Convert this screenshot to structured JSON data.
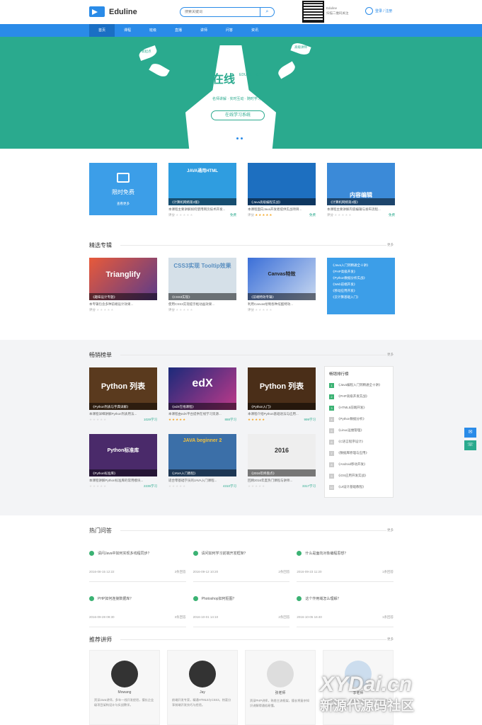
{
  "header": {
    "logo_text": "Eduline",
    "search_placeholder": "搜索关键词",
    "qr_text_1": "Eduline",
    "qr_text_2": "扫描二维码关注",
    "login_text": "登录 / 注册"
  },
  "nav": [
    "首页",
    "课程",
    "班级",
    "直播",
    "讲师",
    "问答",
    "资讯"
  ],
  "banner": {
    "title": "在线",
    "title_sub": "EDULINE 教育",
    "tagline": "名师讲解 · 实时互动 · 随时学习",
    "button": "在线学习系统",
    "leaves": [
      "新起点",
      "高级讲师",
      "新起点",
      "高级讲师"
    ]
  },
  "row1": {
    "free_title": "限时免费",
    "free_more": "查看更多",
    "cards": [
      {
        "cap": "《计算机网络第2版》",
        "big": "JAVA通用HTML",
        "desc": "本课程主要讲解如何使用网页技术开发...",
        "meta": "评分",
        "count": "免费",
        "bg": "#2f9de0"
      },
      {
        "cap": "《Java高级编程实战》",
        "big": "",
        "desc": "本课程面向Java开发者提供实战项目...",
        "meta": "评分",
        "count": "免费",
        "bg": "#1d6fc0"
      },
      {
        "cap": "《计算机网络第2版》",
        "big": "内容编辑",
        "desc": "本课程主要讲解内容编辑与发布流程...",
        "meta": "评分",
        "count": "免费",
        "bg": "#3b8ad8"
      }
    ]
  },
  "sec2": {
    "title": "精选专辑",
    "more": "更多",
    "cards": [
      {
        "cap": "《趣味设计专题》",
        "big": "Trianglify",
        "desc": "本专辑包含多种前端设计效果...",
        "meta": "评分",
        "bg": "#5b3b8a"
      },
      {
        "cap": "《CSS3实现》",
        "big": "CSS3实现 Tooltip效果",
        "desc": "使用CSS3实现提示框动画效果...",
        "meta": "评分",
        "bg": "#c9d6df"
      },
      {
        "cap": "《前端特效专辑》",
        "big": "Canvas特效",
        "desc": "利用Canvas绘制各种炫酷特效...",
        "meta": "评分",
        "bg": "#5477c8"
      }
    ],
    "list": [
      "《Java入门到精通全十讲》",
      "《PHP高级开发》",
      "《Python数据分析实战》",
      "《Web前端开发》",
      "《移动应用开发》",
      "《云计算基础入门》"
    ]
  },
  "sec3": {
    "title": "畅销榜单",
    "more": "更多",
    "cards": [
      {
        "cap": "《Python列表与字典详解》",
        "big": "Python 列表",
        "desc": "本课程详细讲解Python列表用法...",
        "count": "1029学习",
        "bg": "#5a3a1e",
        "stars": "★★★★★",
        "on": false
      },
      {
        "cap": "《edX在线课程》",
        "big": "edX",
        "desc": "本课程由edX平台提供在线学习资源...",
        "count": "888学习",
        "bg": "#3a2a7a",
        "stars": "★★★★★",
        "on": true
      },
      {
        "cap": "《Python入门》",
        "big": "Python 列表",
        "desc": "本课程介绍Python基础语法与应用...",
        "count": "999学习",
        "bg": "#4a2e18",
        "stars": "★★★★★",
        "on": true
      },
      {
        "cap": "《Python标准库》",
        "big": "Python标准库",
        "desc": "本课程讲解Python标准库的常用模块...",
        "count": "2235学习",
        "bg": "#4a2a6a",
        "stars": "★★★★★",
        "on": false
      },
      {
        "cap": "《JAVA入门教程》",
        "big": "JAVA beginner 2",
        "desc": "适合零基础学员的JAVA入门课程...",
        "count": "4310学习",
        "bg": "#3b6fa8",
        "stars": "★★★★★",
        "on": false
      },
      {
        "cap": "《2016年终盘点》",
        "big": "2016",
        "desc": "回顾2016年度热门课程与讲师...",
        "count": "3317学习",
        "bg": "#e8e8e8",
        "stars": "★★★★★",
        "on": false
      }
    ],
    "rank_title": "畅销排行榜",
    "rank": [
      "《Java编程入门到精通全十讲》",
      "《PHP高级开发实战》",
      "《HTML5前端开发》",
      "《Python数据分析》",
      "《Linux运维管理》",
      "《C语言程序设计》",
      "《数据库原理与应用》",
      "《Android移动开发》",
      "《iOS应用开发实战》",
      "《UI设计基础教程》"
    ]
  },
  "sec4": {
    "title": "热门问答",
    "more": "更多",
    "items": [
      {
        "q": "请问Java中如何实现多线程同步？",
        "date": "2016-08-15 12:22",
        "a": "3条回答"
      },
      {
        "q": "请问如何学习前端开发框架？",
        "date": "2016-09-12 10:20",
        "a": "2条回答"
      },
      {
        "q": "什么是面向对象编程思想？",
        "date": "2016-09-23 11:20",
        "a": "1条回答"
      },
      {
        "q": "PHP如何连接数据库？",
        "date": "2016-09-28 09:30",
        "a": "3条回答"
      },
      {
        "q": "Photoshop如何抠图？",
        "date": "2016-10-01 14:10",
        "a": "2条回答"
      },
      {
        "q": "这个作用域怎么理解？",
        "date": "2016-10-05 16:40",
        "a": "1条回答"
      }
    ]
  },
  "sec5": {
    "title": "推荐讲师",
    "more": "更多",
    "teachers": [
      {
        "name": "Mowang",
        "bio": "资深Java讲师，多年一线开发经验，擅长企业级项目架构设计与实战教学。"
      },
      {
        "name": "Jay",
        "bio": "前端开发专家，精通HTML5与CSS3，热衷分享前端开发技巧与经验。"
      },
      {
        "name": "张老师",
        "bio": "资深PHP讲师，熟悉主流框架，擅长将复杂知识讲解得通俗易懂。"
      },
      {
        "name": "李老师",
        "bio": "资深UI设计师，多年设计教学经验，作品获得多项行业奖项认可。"
      }
    ]
  },
  "watermark": {
    "line1": "XYDai.cn",
    "line2": "新源代源码社区"
  }
}
